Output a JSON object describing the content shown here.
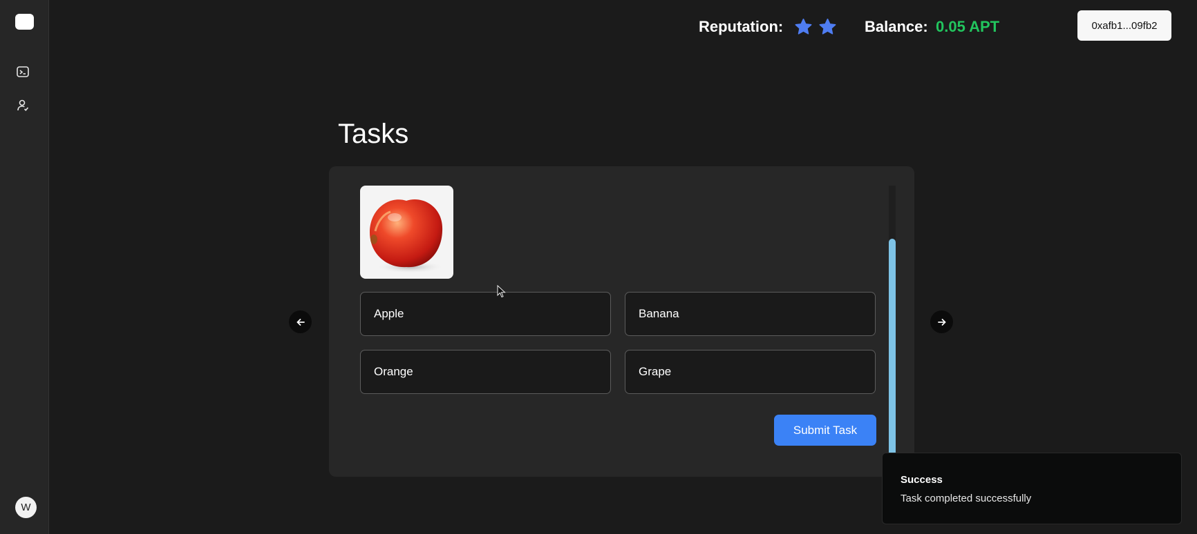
{
  "sidebar": {
    "avatar_letter": "W",
    "icons": [
      "terminal-icon",
      "user-check-icon"
    ]
  },
  "header": {
    "reputation_label": "Reputation:",
    "reputation_stars": 2,
    "balance_label": "Balance:",
    "balance_value": "0.05 APT",
    "wallet_address": "0xafb1...09fb2"
  },
  "main": {
    "title": "Tasks",
    "options": [
      "Apple",
      "Banana",
      "Orange",
      "Grape"
    ],
    "submit_label": "Submit Task"
  },
  "toast": {
    "title": "Success",
    "message": "Task completed successfully"
  },
  "colors": {
    "accent_blue": "#3b82f6",
    "balance_green": "#22c55e",
    "star_blue": "#4f7df2",
    "scrollbar": "#7ec3e6"
  }
}
